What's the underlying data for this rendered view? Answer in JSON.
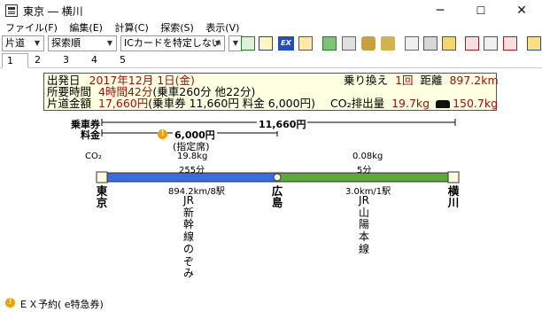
{
  "window": {
    "title": "東京 ― 横川",
    "minimize": "─",
    "maximize": "☐",
    "close": "✕"
  },
  "menu": [
    {
      "label": "ファイル(F)"
    },
    {
      "label": "編集(E)"
    },
    {
      "label": "計算(C)"
    },
    {
      "label": "探索(S)"
    },
    {
      "label": "表示(V)"
    }
  ],
  "toolbar": {
    "ticket_type": "片道",
    "search_order": "探索順",
    "ic_card": "ICカードを特定しない",
    "icons": [
      "calendar-icon",
      "route-icon",
      "ex-icon",
      "copy-icon",
      "timetable-icon",
      "train-icon",
      "fare-icon",
      "map-icon",
      "ticket-icon",
      "print-icon",
      "window-icon",
      "prev-icon",
      "next-icon",
      "export-icon",
      "settings-icon"
    ],
    "ex_label": "EX"
  },
  "tabs": [
    "1",
    "2",
    "3",
    "4",
    "5"
  ],
  "summary": {
    "depart_label": "出発日",
    "depart_value": "2017年12月 1日(金)",
    "time_label": "所要時間",
    "time_value": "4時間42分",
    "time_detail": "(乗車260分 他22分)",
    "fare_label": "片道金額",
    "fare_value": "17,660円",
    "fare_detail": "(乗車券 11,660円 料金 6,000円)",
    "transfer_label": "乗り換え",
    "transfer_value": "1回",
    "distance_label": "距離",
    "distance_value": "897.2km",
    "co2_label": "CO₂排出量",
    "co2_value": "19.7kg",
    "car_value": "150.7kg"
  },
  "route": {
    "ticket_label": "乗車券",
    "ticket_amount": "11,660円",
    "charge_label": "料金",
    "charge_amount": "6,000円",
    "charge_note": "(指定席)",
    "co2_label": "CO₂",
    "seg1": {
      "co2": "19.8kg",
      "minutes": "255分",
      "distance": "894.2km/8駅",
      "line": "JR新幹線のぞみ",
      "color": "#3a6edc"
    },
    "seg2": {
      "co2": "0.08kg",
      "minutes": "5分",
      "distance": "3.0km/1駅",
      "line": "JR山陽本線",
      "color": "#5fa83c"
    },
    "stations": [
      "東京",
      "広島",
      "横川"
    ]
  },
  "footer": {
    "text": "ＥＸ予約( e特急券)"
  }
}
